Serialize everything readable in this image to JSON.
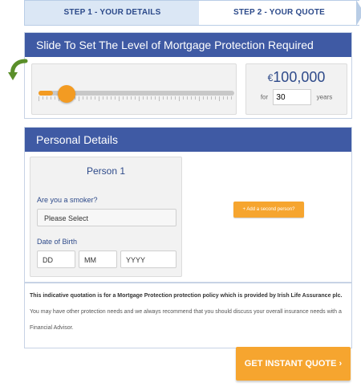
{
  "steps": {
    "step1_label": "STEP 1 - YOUR DETAILS",
    "step2_label": "STEP 2 - YOUR QUOTE"
  },
  "slider_section": {
    "title": "Slide To Set The Level of Mortgage Protection Required",
    "currency_symbol": "€",
    "amount": "100,000",
    "for_label": "for",
    "years_value": "30",
    "years_label": "years",
    "slider_level_percent": 8
  },
  "details_section": {
    "title": "Personal Details",
    "person_title": "Person 1",
    "smoker_label": "Are you a smoker?",
    "smoker_select_value": "Please Select",
    "dob_label": "Date of Birth",
    "dd_placeholder": "DD",
    "mm_placeholder": "MM",
    "yyyy_placeholder": "YYYY",
    "add_person_label": "+ Add a second person?"
  },
  "info": {
    "bold_text": "This indicative quotation is for a Mortgage Protection protection policy which is provided by Irish Life Assurance plc.",
    "rest_text": " You may have other protection needs and we always recommend that you should discuss your overall insurance needs with a Financial Advisor."
  },
  "quote_button": {
    "label": "GET INSTANT QUOTE ›"
  },
  "colors": {
    "header_blue": "#3f5aa4",
    "accent_orange": "#f6a52f"
  }
}
